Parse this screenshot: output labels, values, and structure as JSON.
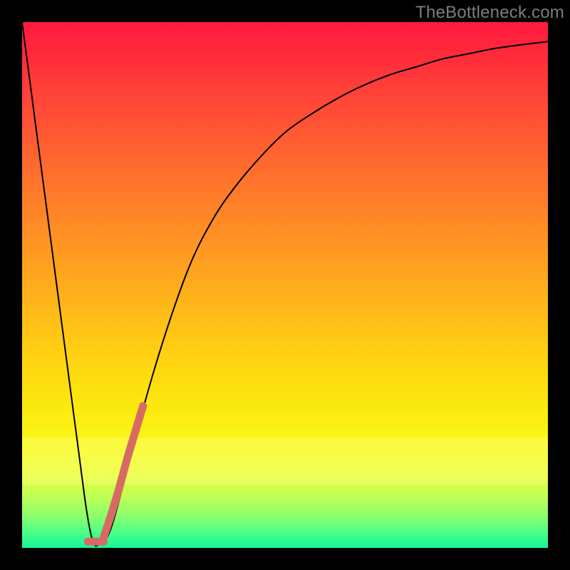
{
  "watermark": "TheBottleneck.com",
  "chart_data": {
    "type": "line",
    "title": "",
    "xlabel": "",
    "ylabel": "",
    "xlim": [
      0,
      100
    ],
    "ylim": [
      0,
      100
    ],
    "series": [
      {
        "name": "main-curve",
        "color": "#000000",
        "stroke_width": 2,
        "x": [
          0,
          5,
          10,
          13,
          15,
          17,
          20,
          24,
          28,
          32,
          36,
          40,
          45,
          50,
          55,
          60,
          65,
          70,
          75,
          80,
          85,
          90,
          95,
          100
        ],
        "values": [
          100,
          62,
          24,
          3,
          1,
          4,
          15,
          30,
          43,
          54,
          62,
          68,
          74,
          79,
          82.5,
          85.5,
          88,
          90,
          91.5,
          93,
          94,
          95,
          95.7,
          96.3
        ]
      },
      {
        "name": "highlight-segment",
        "color": "#d76b63",
        "stroke_width": 11,
        "linecap": "round",
        "x": [
          15.5,
          17,
          18.5,
          20,
          21.5,
          23
        ],
        "values": [
          2,
          6.5,
          11.5,
          17,
          22,
          27
        ]
      },
      {
        "name": "bottom-marker",
        "color": "#d76b63",
        "stroke_width": 11,
        "linecap": "round",
        "x": [
          12.5,
          15.5
        ],
        "values": [
          1.2,
          1.2
        ]
      }
    ],
    "yellow_band": {
      "from_y": 12,
      "to_y": 21
    }
  }
}
